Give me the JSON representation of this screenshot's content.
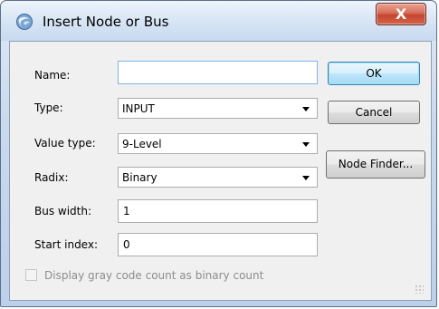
{
  "window": {
    "title": "Insert Node or Bus",
    "close_label": "X"
  },
  "form": {
    "name": {
      "label": "Name:",
      "value": ""
    },
    "type": {
      "label": "Type:",
      "value": "INPUT"
    },
    "value_type": {
      "label": "Value type:",
      "value": "9-Level"
    },
    "radix": {
      "label": "Radix:",
      "value": "Binary"
    },
    "bus_width": {
      "label": "Bus width:",
      "value": "1"
    },
    "start_index": {
      "label": "Start index:",
      "value": "0"
    },
    "gray_code": {
      "label": "Display gray code count as binary count",
      "checked": false,
      "enabled": false
    }
  },
  "buttons": {
    "ok": "OK",
    "cancel": "Cancel",
    "node_finder": "Node Finder..."
  },
  "icons": {
    "app": "quartus-app-icon",
    "close": "close-icon"
  },
  "colors": {
    "default_button_border": "#3c7fb1",
    "close_button": "#c5452e",
    "disabled_text": "#8d8d8d"
  }
}
